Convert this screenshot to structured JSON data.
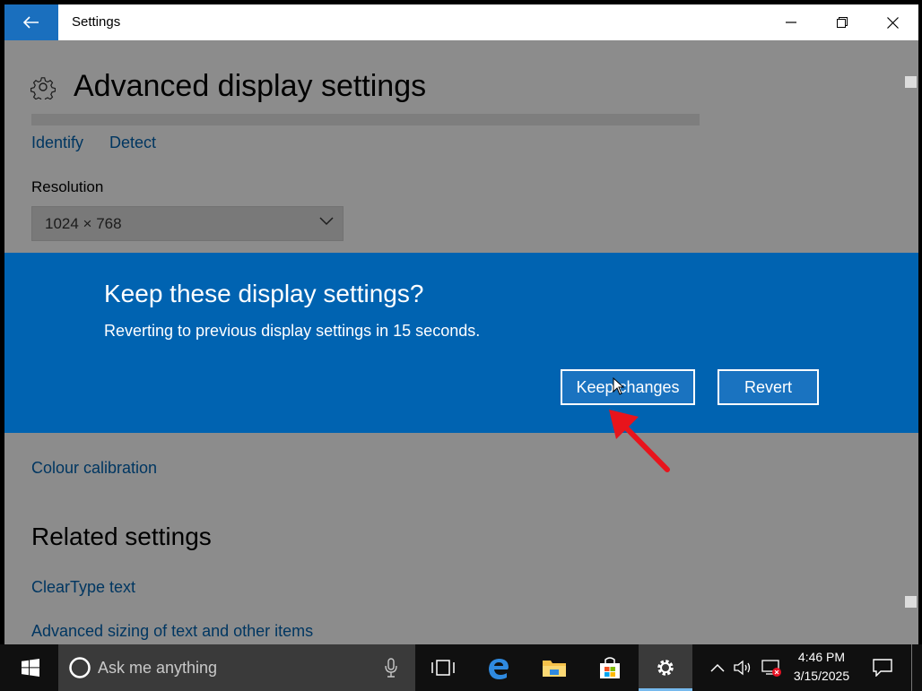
{
  "window": {
    "app_title": "Settings"
  },
  "page": {
    "title": "Advanced display settings",
    "identify_link": "Identify",
    "detect_link": "Detect",
    "resolution_label": "Resolution",
    "resolution_value": "1024 × 768",
    "colour_calibration_link": "Colour calibration",
    "related_settings_title": "Related settings",
    "cleartype_link": "ClearType text",
    "advanced_sizing_link": "Advanced sizing of text and other items"
  },
  "dialog": {
    "title": "Keep these display settings?",
    "message": "Reverting to previous display settings in 15 seconds.",
    "keep_label": "Keep changes",
    "revert_label": "Revert"
  },
  "taskbar": {
    "search_placeholder": "Ask me anything",
    "time": "4:46 PM",
    "date": "3/15/2025",
    "icons": [
      "windows-start-icon",
      "cortana-icon",
      "microphone-icon",
      "task-view-icon",
      "edge-icon",
      "file-explorer-icon",
      "store-icon",
      "settings-gear-icon",
      "chevron-up-icon",
      "volume-icon",
      "network-icon",
      "action-center-icon"
    ]
  },
  "colors": {
    "accent": "#0063b1",
    "taskbar": "#101010",
    "annotation_arrow": "#e8141c"
  }
}
